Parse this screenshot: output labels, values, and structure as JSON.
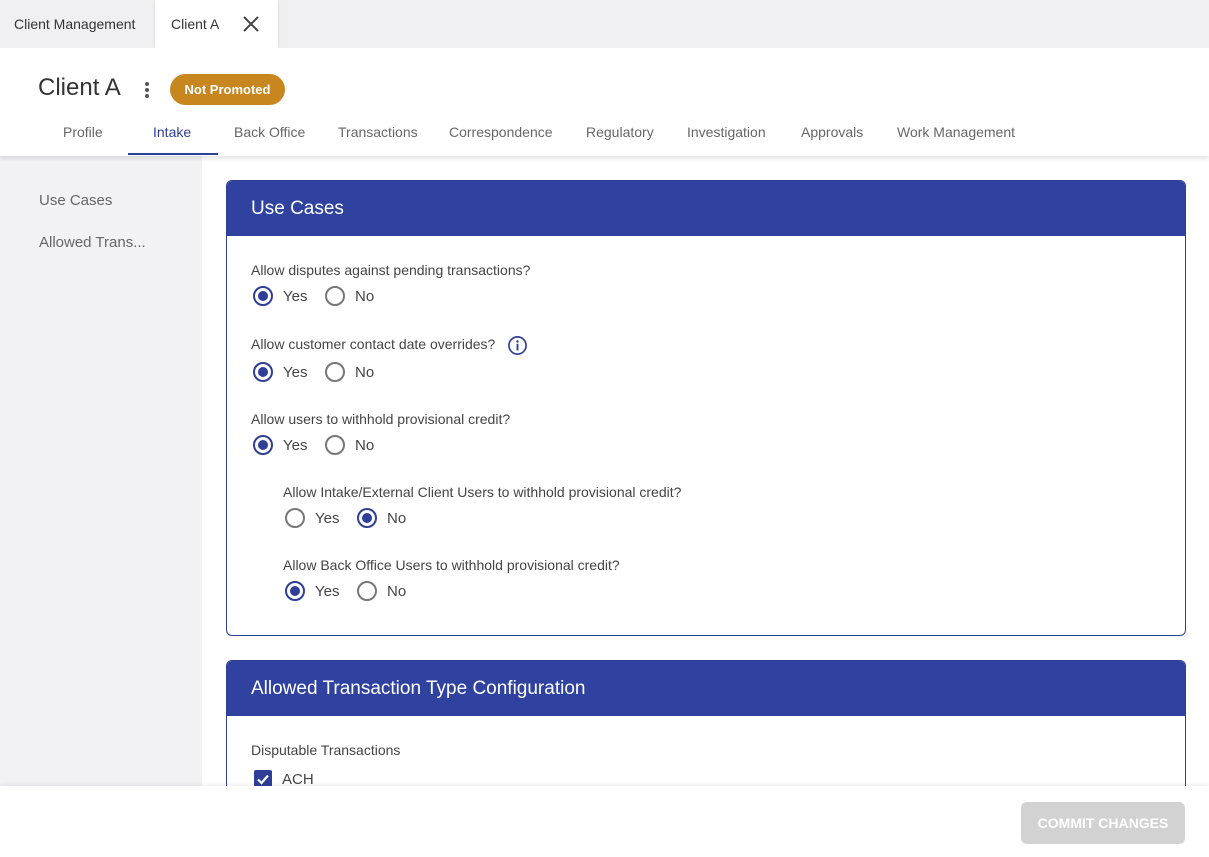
{
  "window_tabs": [
    {
      "label": "Client Management"
    },
    {
      "label": "Client A"
    }
  ],
  "header": {
    "title": "Client A",
    "status_badge": "Not Promoted"
  },
  "nav_tabs": [
    {
      "label": "Profile"
    },
    {
      "label": "Intake",
      "active": true
    },
    {
      "label": "Back Office"
    },
    {
      "label": "Transactions"
    },
    {
      "label": "Correspondence"
    },
    {
      "label": "Regulatory"
    },
    {
      "label": "Investigation"
    },
    {
      "label": "Approvals"
    },
    {
      "label": "Work Management"
    }
  ],
  "sidebar": {
    "items": [
      {
        "label": "Use Cases"
      },
      {
        "label": "Allowed Trans..."
      }
    ]
  },
  "use_cases": {
    "title": "Use Cases",
    "yes_label": "Yes",
    "no_label": "No",
    "questions": [
      {
        "text": "Allow disputes against pending transactions?",
        "selected": "Yes"
      },
      {
        "text": "Allow customer contact date overrides?",
        "selected": "Yes",
        "info_icon": "info-icon"
      },
      {
        "text": "Allow users to withhold provisional credit?",
        "selected": "Yes"
      },
      {
        "text": "Allow Intake/External Client Users to withhold provisional credit?",
        "selected": "No"
      },
      {
        "text": "Allow Back Office Users to withhold provisional credit?",
        "selected": "Yes"
      }
    ]
  },
  "transaction_config": {
    "title": "Allowed Transaction Type Configuration",
    "section_label": "Disputable Transactions",
    "checkboxes": [
      {
        "label": "ACH",
        "checked": true
      }
    ]
  },
  "footer": {
    "commit_label": "COMMIT CHANGES"
  },
  "colors": {
    "primary": "#2f42a0",
    "badge": "#c8861e",
    "disabled_button": "#d2d2d2"
  }
}
